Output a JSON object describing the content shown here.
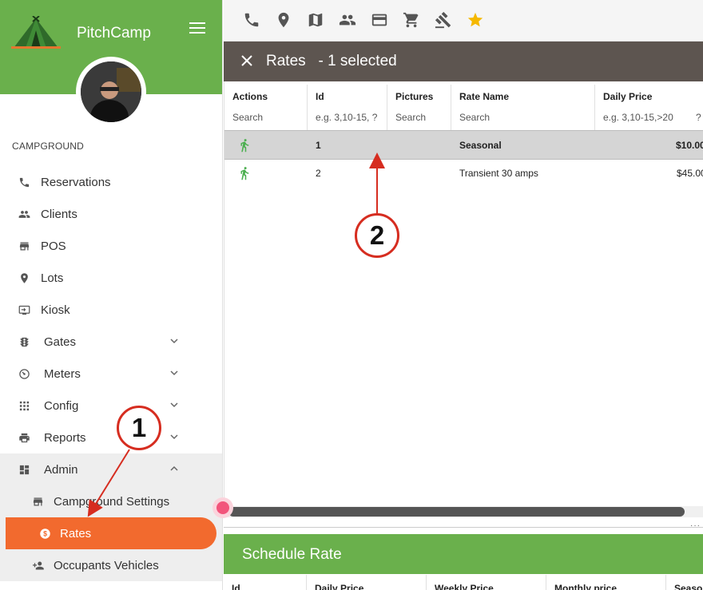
{
  "app": {
    "name": "PitchCamp"
  },
  "sidebar": {
    "section_label": "CAMPGROUND",
    "items": [
      {
        "label": "Reservations",
        "icon": "phone-icon"
      },
      {
        "label": "Clients",
        "icon": "people-icon"
      },
      {
        "label": "POS",
        "icon": "store-icon"
      },
      {
        "label": "Lots",
        "icon": "location-pin-icon"
      },
      {
        "label": "Kiosk",
        "icon": "kiosk-icon"
      },
      {
        "label": "Gates",
        "icon": "traffic-light-icon",
        "expandable": true
      },
      {
        "label": "Meters",
        "icon": "meter-icon",
        "expandable": true
      },
      {
        "label": "Config",
        "icon": "grid-icon",
        "expandable": true
      },
      {
        "label": "Reports",
        "icon": "printer-icon",
        "expandable": true
      },
      {
        "label": "Admin",
        "icon": "dashboard-icon",
        "expanded": true
      }
    ],
    "admin_items": [
      {
        "label": "Campground Settings",
        "icon": "store-icon"
      },
      {
        "label": "Rates",
        "icon": "dollar-icon",
        "active": true
      },
      {
        "label": "Occupants Vehicles",
        "icon": "person-add-icon"
      }
    ]
  },
  "toolbar": {
    "icons": [
      "phone-icon",
      "location-pin-icon",
      "map-icon",
      "people-icon",
      "credit-card-icon",
      "cart-icon",
      "gavel-icon",
      "star-icon"
    ]
  },
  "selection_bar": {
    "title": "Rates",
    "selected_text": "- 1 selected"
  },
  "rates_table": {
    "columns": [
      {
        "title": "Actions",
        "filter": "Search"
      },
      {
        "title": "Id",
        "filter": "e.g. 3,10-15, ?"
      },
      {
        "title": "Pictures",
        "filter": "Search"
      },
      {
        "title": "Rate Name",
        "filter": "Search"
      },
      {
        "title": "Daily Price",
        "filter": "e.g. 3,10-15,>20",
        "help": "?"
      }
    ],
    "rows": [
      {
        "id": "1",
        "name": "Seasonal",
        "daily_price": "$10.00",
        "selected": true
      },
      {
        "id": "2",
        "name": "Transient 30 amps",
        "daily_price": "$45.00",
        "selected": false
      }
    ]
  },
  "schedule": {
    "title": "Schedule Rate",
    "columns": [
      "Id",
      "Daily Price",
      "Weekly Price",
      "Monthly price",
      "Season"
    ]
  },
  "callouts": [
    "1",
    "2"
  ],
  "colors": {
    "green": "#6ab04c",
    "orange": "#f26a2e",
    "dark_bar": "#5d5550",
    "callout_red": "#d62d20",
    "star": "#f5b800"
  }
}
